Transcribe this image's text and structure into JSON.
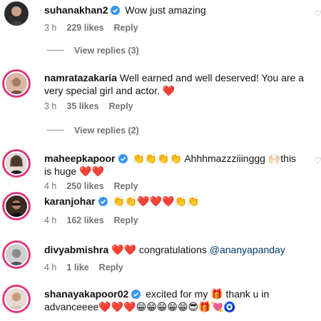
{
  "comments": [
    {
      "username": "suhanakhan2",
      "verified": true,
      "text": "Wow just amazing",
      "time": "3 h",
      "likes": "229 likes",
      "reply": "Reply",
      "view_replies": "View replies (3)"
    },
    {
      "username": "namratazakaria",
      "verified": false,
      "text": "Well earned and well deserved! You are a very special girl and actor. ❤️",
      "time": "3 h",
      "likes": "35 likes",
      "reply": "Reply",
      "view_replies": "View replies (2)"
    },
    {
      "username": "maheepkapoor",
      "verified": true,
      "text": "👏👏👏👏 Ahhhmazzziiinggg 🙌🏻this is huge ❤️❤️",
      "time": "4 h",
      "likes": "250 likes",
      "reply": "Reply"
    },
    {
      "username": "karanjohar",
      "verified": true,
      "text": "👏👏❤️❤️❤️👏👏",
      "time": "4 h",
      "likes": "162 likes",
      "reply": "Reply"
    },
    {
      "username": "divyabmishra",
      "verified": false,
      "text_before": "❤️❤️ congratulations ",
      "mention": "@ananyapanday",
      "time": "4 h",
      "likes": "1 like",
      "reply": "Reply"
    },
    {
      "username": "shanayakapoor02",
      "verified": true,
      "text": "excited for my 🎁 thank u in advanceeee❤️❤️❤️😁😁😁😁😁😎🎁💘🧿"
    }
  ],
  "colors": {
    "verified": "#3897f0",
    "meta": "#737373",
    "mention": "#00376b",
    "ring": "#d6249f"
  },
  "icons": {
    "verified": "verified-badge-icon",
    "like": "heart-outline-icon"
  }
}
